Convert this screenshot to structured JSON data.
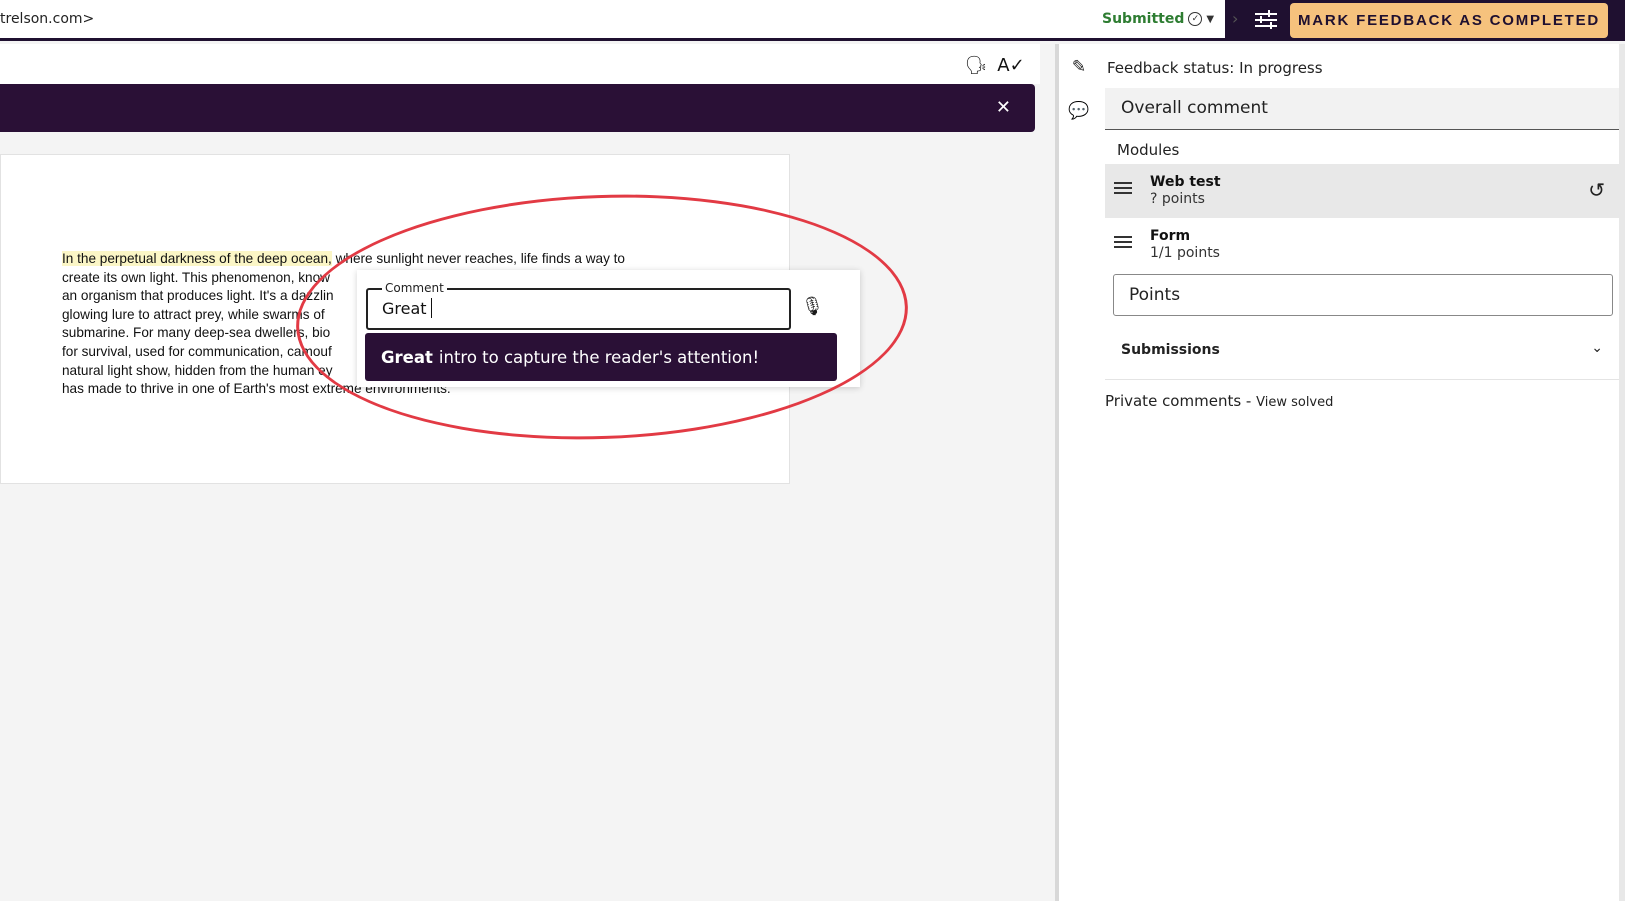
{
  "topbar": {
    "email_fragment": "trelson.com>",
    "status": "Submitted",
    "mark_button": "MARK FEEDBACK AS COMPLETED",
    "colors": {
      "dark": "#1f1030",
      "accent": "#f6c27d",
      "submitted": "#2e7d32"
    }
  },
  "document": {
    "highlighted": "In the perpetual darkness of the deep ocean,",
    "lines": [
      " where sunlight never reaches, life finds a way to",
      "create its own light. This phenomenon, know",
      "an organism that produces light. It's a dazzlin",
      "glowing lure to attract prey, while swarms of",
      "submarine. For many deep-sea dwellers, bio",
      "for survival, used for communication, camouf",
      "natural light show, hidden from the human ey",
      "has made to thrive in one of Earth's most extreme environments."
    ]
  },
  "comment": {
    "label": "Comment",
    "value": "Great",
    "suggestion_bold": "Great",
    "suggestion_rest": "intro to capture the reader's attention!"
  },
  "panel": {
    "status": "Feedback status: In progress",
    "overall_comment": "Overall comment",
    "modules_heading": "Modules",
    "modules": [
      {
        "title": "Web test",
        "sub": "? points"
      },
      {
        "title": "Form",
        "sub": "1/1 points"
      }
    ],
    "points_placeholder": "Points",
    "submissions": "Submissions",
    "private_comments": "Private comments -",
    "view_solved": "View solved"
  }
}
